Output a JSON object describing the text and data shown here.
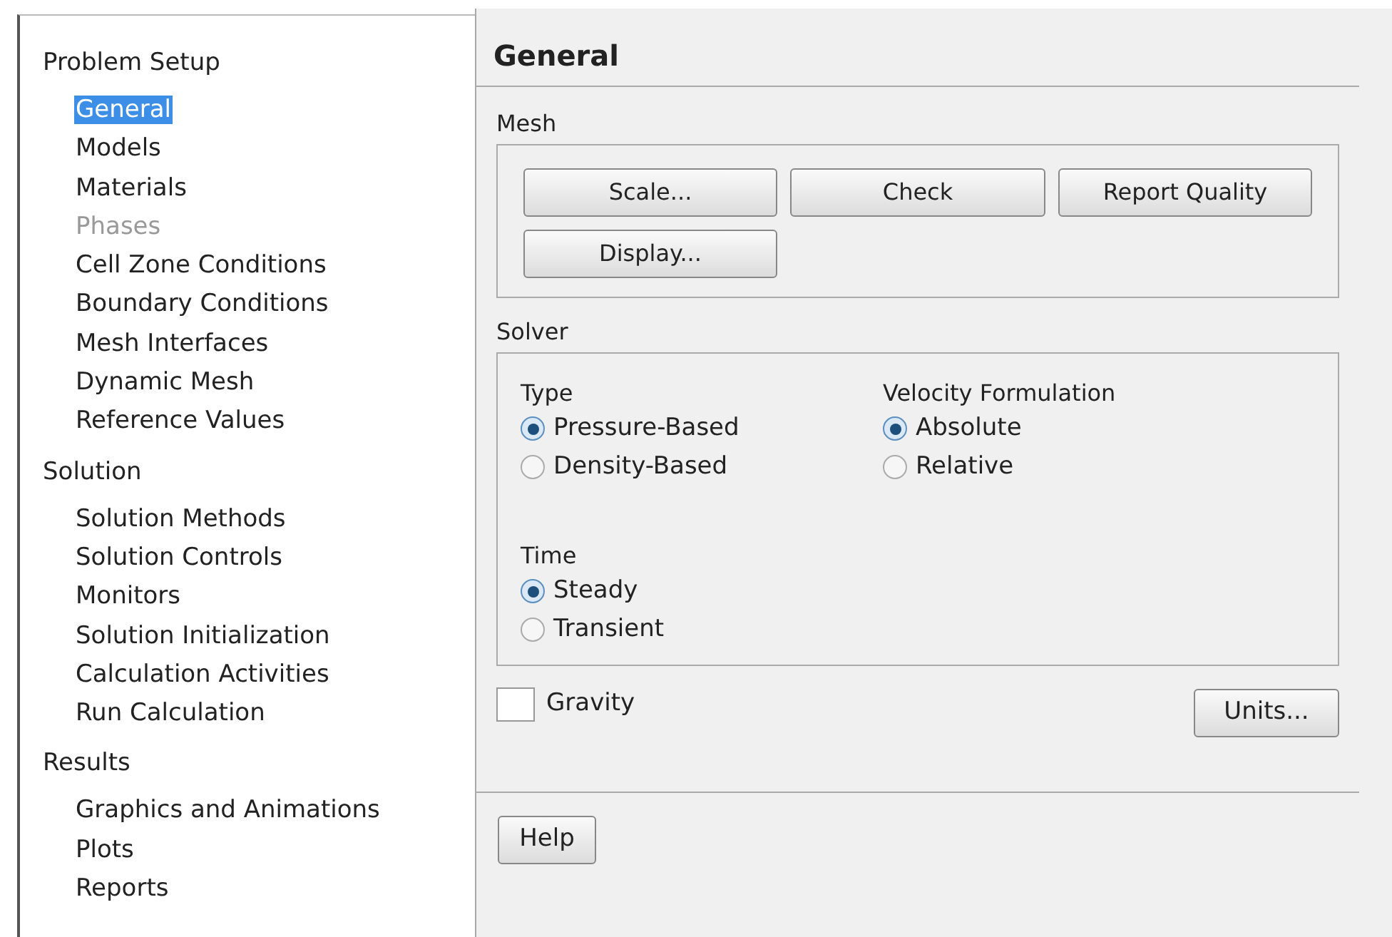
{
  "tree": [
    {
      "label": "Problem Setup",
      "children": [
        {
          "label": "General",
          "selected": true,
          "disabled": false
        },
        {
          "label": "Models",
          "selected": false,
          "disabled": false
        },
        {
          "label": "Materials",
          "selected": false,
          "disabled": false
        },
        {
          "label": "Phases",
          "selected": false,
          "disabled": true
        },
        {
          "label": "Cell Zone Conditions",
          "selected": false,
          "disabled": false
        },
        {
          "label": "Boundary Conditions",
          "selected": false,
          "disabled": false
        },
        {
          "label": "Mesh Interfaces",
          "selected": false,
          "disabled": false
        },
        {
          "label": "Dynamic Mesh",
          "selected": false,
          "disabled": false
        },
        {
          "label": "Reference Values",
          "selected": false,
          "disabled": false
        }
      ]
    },
    {
      "label": "Solution",
      "children": [
        {
          "label": "Solution Methods",
          "selected": false,
          "disabled": false
        },
        {
          "label": "Solution Controls",
          "selected": false,
          "disabled": false
        },
        {
          "label": "Monitors",
          "selected": false,
          "disabled": false
        },
        {
          "label": "Solution Initialization",
          "selected": false,
          "disabled": false
        },
        {
          "label": "Calculation Activities",
          "selected": false,
          "disabled": false
        },
        {
          "label": "Run Calculation",
          "selected": false,
          "disabled": false
        }
      ]
    },
    {
      "label": "Results",
      "children": [
        {
          "label": "Graphics and Animations",
          "selected": false,
          "disabled": false
        },
        {
          "label": "Plots",
          "selected": false,
          "disabled": false
        },
        {
          "label": "Reports",
          "selected": false,
          "disabled": false
        }
      ]
    }
  ],
  "panel": {
    "title": "General",
    "mesh": {
      "label": "Mesh",
      "buttons": [
        "Scale...",
        "Check",
        "Report Quality",
        "Display..."
      ]
    },
    "solver": {
      "label": "Solver",
      "groups": [
        {
          "label": "Type",
          "options": [
            {
              "label": "Pressure-Based",
              "selected": true
            },
            {
              "label": "Density-Based",
              "selected": false
            }
          ]
        },
        {
          "label": "Velocity Formulation",
          "options": [
            {
              "label": "Absolute",
              "selected": true
            },
            {
              "label": "Relative",
              "selected": false
            }
          ]
        },
        {
          "label": "Time",
          "options": [
            {
              "label": "Steady",
              "selected": true
            },
            {
              "label": "Transient",
              "selected": false
            }
          ]
        }
      ]
    },
    "gravity": {
      "label": "Gravity",
      "checked": false
    },
    "units_button": "Units...",
    "help_button": "Help"
  }
}
